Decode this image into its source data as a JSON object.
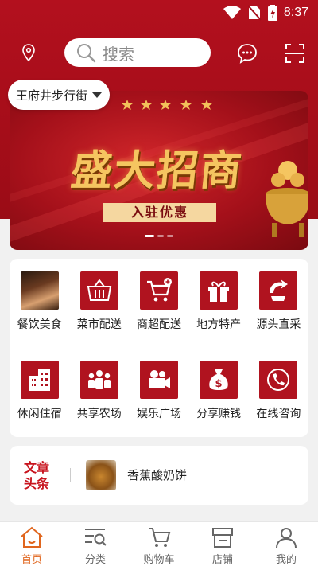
{
  "status_bar": {
    "time": "8:37"
  },
  "search": {
    "placeholder": "搜索"
  },
  "location": {
    "label": "王府井步行街"
  },
  "banner": {
    "title": "盛大招商",
    "subtitle": "入驻优惠"
  },
  "categories": [
    {
      "label": "餐饮美食",
      "icon": "food-photo-icon"
    },
    {
      "label": "菜市配送",
      "icon": "basket-icon"
    },
    {
      "label": "商超配送",
      "icon": "cart-plus-icon"
    },
    {
      "label": "地方特产",
      "icon": "gift-icon"
    },
    {
      "label": "源头直采",
      "icon": "source-icon"
    },
    {
      "label": "休闲住宿",
      "icon": "building-icon"
    },
    {
      "label": "共享农场",
      "icon": "people-icon"
    },
    {
      "label": "娱乐广场",
      "icon": "video-camera-icon"
    },
    {
      "label": "分享赚钱",
      "icon": "money-bag-icon"
    },
    {
      "label": "在线咨询",
      "icon": "phone-icon"
    }
  ],
  "news": {
    "tag": "文章头条",
    "title": "香蕉酸奶饼"
  },
  "tabbar": [
    {
      "label": "首页",
      "icon": "home-icon",
      "active": true
    },
    {
      "label": "分类",
      "icon": "category-icon",
      "active": false
    },
    {
      "label": "购物车",
      "icon": "cart-icon",
      "active": false
    },
    {
      "label": "店铺",
      "icon": "store-icon",
      "active": false
    },
    {
      "label": "我的",
      "icon": "user-icon",
      "active": false
    }
  ],
  "colors": {
    "brand_red": "#b3101e",
    "accent_orange": "#e0661e",
    "icon_red": "#b0131f"
  }
}
